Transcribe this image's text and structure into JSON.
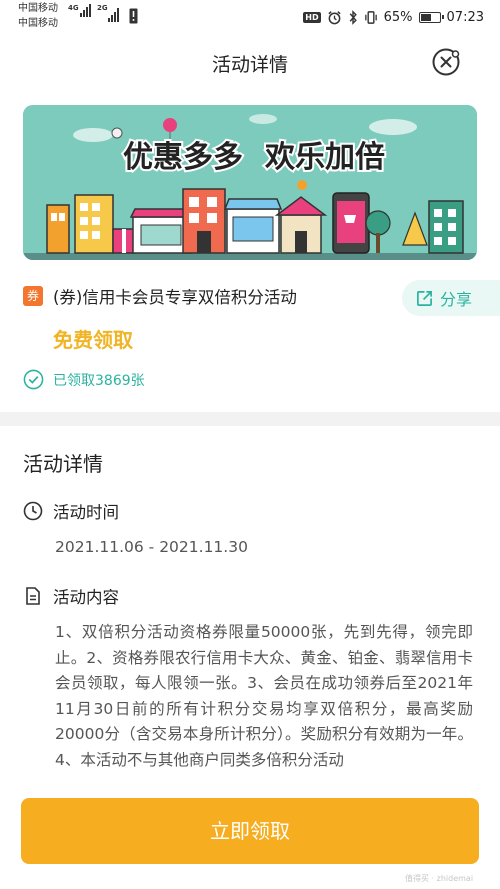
{
  "status_bar": {
    "carrier_1": "中国移动",
    "carrier_2": "中国移动",
    "net_1": "4G",
    "net_2": "2G",
    "hd": "HD",
    "battery_text": "65%",
    "battery_level": 0.65,
    "time": "07:23"
  },
  "header": {
    "title": "活动详情",
    "close_icon": "close-icon"
  },
  "banner": {
    "headline_left": "优惠多多",
    "headline_right": "欢乐加倍",
    "colors": {
      "background": "#7ccbbd",
      "accent": "#e8417e"
    }
  },
  "coupon": {
    "badge": "券",
    "title": "(券)信用卡会员专享双倍积分活动",
    "price_label": "免费领取",
    "claimed_text": "已领取3869张",
    "share_label": "分享"
  },
  "detail": {
    "section_title": "活动详情",
    "time_label": "活动时间",
    "time_value": "2021.11.06 - 2021.11.30",
    "content_label": "活动内容",
    "content_text": "1、双倍积分活动资格券限量50000张，先到先得，领完即止。2、资格券限农行信用卡大众、黄金、铂金、翡翠信用卡会员领取，每人限领一张。3、会员在成功领券后至2021年11月30日前的所有计积分交易均享双倍积分，最高奖励20000分（含交易本身所计积分）。奖励积分有效期为一年。4、本活动不与其他商户同类多倍积分活动"
  },
  "cta": {
    "label": "立即领取"
  },
  "watermark": {
    "text": "值得买 · zhidemai"
  },
  "colors": {
    "teal": "#2bb3a0",
    "orange_badge": "#f2762e",
    "gold_text": "#f0b425",
    "cta_button": "#f6ad1f"
  }
}
